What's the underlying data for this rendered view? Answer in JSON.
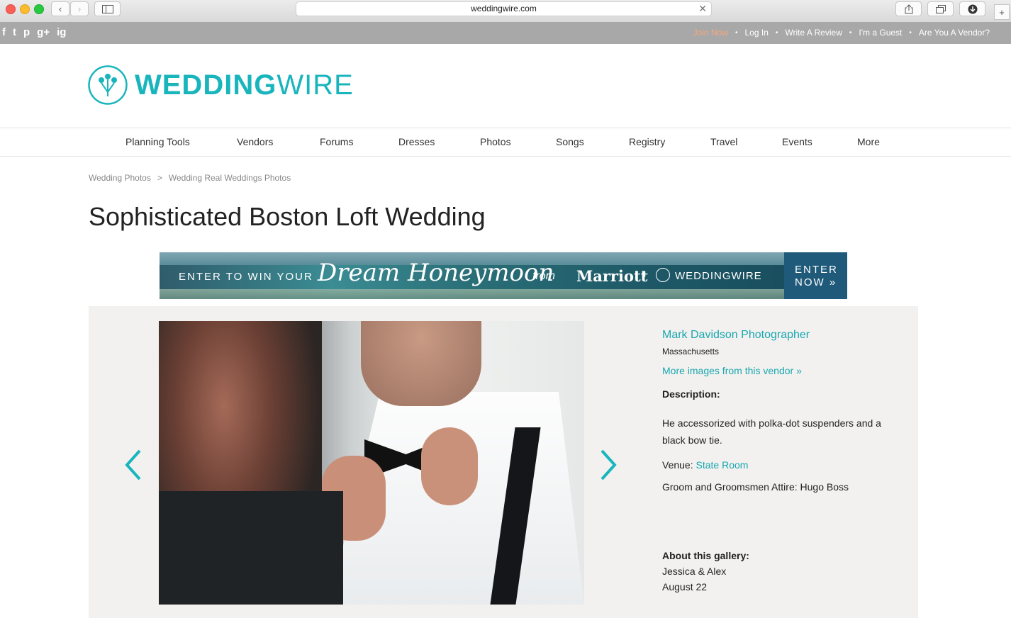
{
  "browser": {
    "url": "weddingwire.com"
  },
  "topbar": {
    "social": [
      "f",
      "t",
      "p",
      "g+",
      "ig"
    ],
    "links": [
      "Join Now",
      "Log In",
      "Write A Review",
      "I'm a Guest",
      "Are You A Vendor?"
    ],
    "separator": "•"
  },
  "logo": {
    "bold": "WEDDING",
    "light": "WIRE"
  },
  "nav": [
    "Planning Tools",
    "Vendors",
    "Forums",
    "Dresses",
    "Photos",
    "Songs",
    "Registry",
    "Travel",
    "Events",
    "More"
  ],
  "breadcrumb": {
    "items": [
      "Wedding Photos",
      "Wedding Real Weddings Photos"
    ],
    "arrow": ">"
  },
  "page_title": "Sophisticated Boston Loft Wedding",
  "ad": {
    "line1": "ENTER TO WIN YOUR",
    "script": "Dream Honeymoon",
    "from": "from",
    "brand": "Marriott",
    "plus": "+",
    "partner": "WEDDINGWIRE",
    "cta1": "ENTER",
    "cta2": "NOW »"
  },
  "gallery": {
    "vendor_name": "Mark Davidson Photographer",
    "vendor_location": "Massachusetts",
    "more_images": "More images from this vendor »",
    "description_label": "Description:",
    "description": "He accessorized with polka-dot suspenders and a black bow tie.",
    "venue_label": "Venue:",
    "venue_value": "State Room",
    "attire": "Groom and Groomsmen Attire: Hugo Boss",
    "about_label": "About this gallery:",
    "couple": "Jessica & Alex",
    "date": "August 22"
  },
  "colors": {
    "brand": "#19b5bd",
    "join_now": "#f4a77c",
    "topbar_bg": "#a8a8a8",
    "panel_bg": "#f2f1ef"
  }
}
